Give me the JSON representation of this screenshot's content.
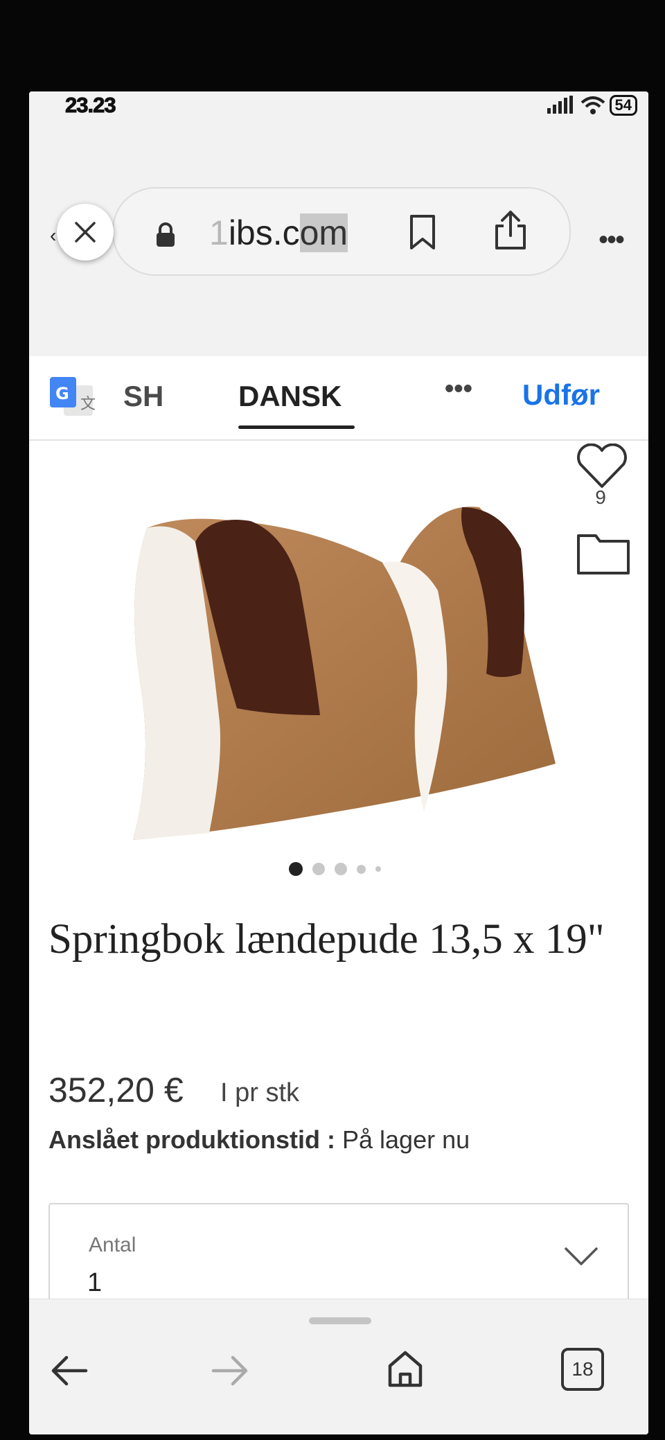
{
  "status_bar": {
    "time": "23.23",
    "battery": "54"
  },
  "browser": {
    "url_dim": "1",
    "url_main": "ibs.c",
    "url_highlight": "om",
    "icons": [
      "close-icon",
      "lock-icon",
      "bookmark-icon",
      "share-icon",
      "more-icon"
    ]
  },
  "translate_bar": {
    "source_lang": "SH",
    "target_lang": "DANSK",
    "more": "•••",
    "done": "Udfør"
  },
  "product": {
    "like_count": "9",
    "image_count": 5,
    "active_image": 1,
    "title": "Springbok lændepude 13,5 x 19\"",
    "price": "352,20 €",
    "unit": "I pr stk",
    "production_label": "Anslået produktionstid :",
    "production_value": " På lager nu",
    "quantity_label": "Antal",
    "quantity_value": "1"
  },
  "bottom_nav": {
    "tab_count": "18"
  }
}
